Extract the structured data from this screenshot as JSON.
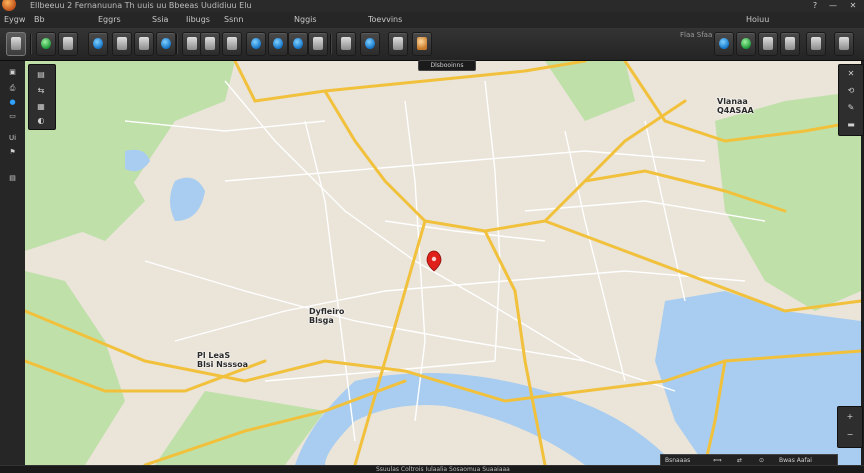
{
  "titlebar": {
    "title": "Ellbeeuu  2  Fernanuuna  Th uuis  uu  Bbeeas  Uudidiuu  Elu",
    "help_label": "?",
    "minimize_label": "—",
    "close_label": "✕"
  },
  "menu": [
    "Eygw",
    "Bb",
    "Eggrs",
    "Ssia",
    "Iibugs",
    "Ssnn",
    "Nggis",
    "Toevvins",
    "Hoiuu"
  ],
  "toolbar": {
    "label": "Flaa  Sfaa",
    "tools": [
      {
        "icon": "layers-icon",
        "style": "grey"
      },
      {
        "icon": "globe-icon",
        "style": "green"
      },
      {
        "icon": "pin-icon",
        "style": "blue"
      },
      {
        "icon": "measure-icon",
        "style": "grey"
      },
      {
        "icon": "clipboard-icon",
        "style": "grey"
      },
      {
        "icon": "flag-icon",
        "style": "grey"
      },
      {
        "icon": "ruler-icon",
        "style": "blue"
      },
      {
        "icon": "document-icon",
        "style": "grey"
      },
      {
        "icon": "folder-icon",
        "style": "grey"
      },
      {
        "icon": "marker-icon",
        "style": "blue"
      },
      {
        "icon": "drop-icon",
        "style": "blue"
      },
      {
        "icon": "water-icon",
        "style": "blue"
      },
      {
        "icon": "tool-icon",
        "style": "grey"
      },
      {
        "icon": "route-icon",
        "style": "grey"
      },
      {
        "icon": "gps-icon",
        "style": "blue"
      },
      {
        "icon": "bucket-icon",
        "style": "orange"
      },
      {
        "icon": "refresh-icon",
        "style": "blue"
      },
      {
        "icon": "satellite-icon",
        "style": "green"
      },
      {
        "icon": "camera-icon",
        "style": "grey"
      },
      {
        "icon": "layers-right-icon",
        "style": "grey"
      }
    ]
  },
  "left_panel": {
    "buttons": [
      "▣",
      "⎙",
      "●",
      "▭",
      "Ui",
      "⚑",
      "▤"
    ]
  },
  "left_float": {
    "buttons": [
      "▤",
      "⇆",
      "▦",
      "◐"
    ]
  },
  "right_float": {
    "buttons": [
      "✕",
      "⟲",
      "✎",
      "▬"
    ]
  },
  "zoom": {
    "in_label": "+",
    "out_label": "−"
  },
  "map": {
    "tooltip": "Dlsbooinns",
    "labels": [
      {
        "text": "Vlanaa\nQ4ASAA"
      },
      {
        "text": "Dyfleiro\nBlsga"
      },
      {
        "text": "Pl LeaS\nBlsi Nsssoa"
      }
    ],
    "marker_color": "#e0201a",
    "road_color": "#f2c13c",
    "water_color": "#a8cdf0",
    "forest_color": "#bfe0a9"
  },
  "status": {
    "text": "Ssuulas  Coltrois  Iulaalia  Sosaomua  Suaaiaaa",
    "coords": [
      "Bsnaaas",
      "⟺",
      "⇄",
      "⊙",
      "Bwas Aafai"
    ]
  }
}
